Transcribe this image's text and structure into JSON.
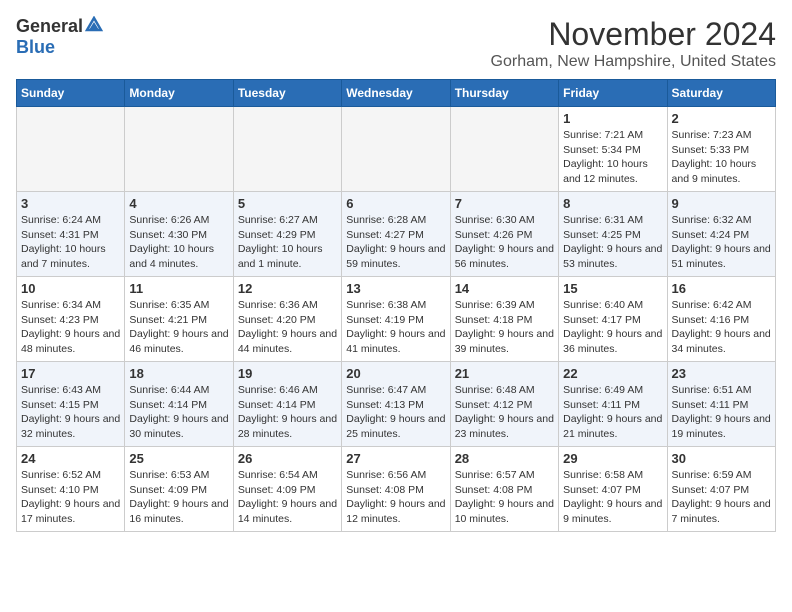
{
  "header": {
    "logo_general": "General",
    "logo_blue": "Blue",
    "month_title": "November 2024",
    "location": "Gorham, New Hampshire, United States"
  },
  "weekdays": [
    "Sunday",
    "Monday",
    "Tuesday",
    "Wednesday",
    "Thursday",
    "Friday",
    "Saturday"
  ],
  "weeks": [
    [
      {
        "day": "",
        "info": ""
      },
      {
        "day": "",
        "info": ""
      },
      {
        "day": "",
        "info": ""
      },
      {
        "day": "",
        "info": ""
      },
      {
        "day": "",
        "info": ""
      },
      {
        "day": "1",
        "info": "Sunrise: 7:21 AM\nSunset: 5:34 PM\nDaylight: 10 hours and 12 minutes."
      },
      {
        "day": "2",
        "info": "Sunrise: 7:23 AM\nSunset: 5:33 PM\nDaylight: 10 hours and 9 minutes."
      }
    ],
    [
      {
        "day": "3",
        "info": "Sunrise: 6:24 AM\nSunset: 4:31 PM\nDaylight: 10 hours and 7 minutes."
      },
      {
        "day": "4",
        "info": "Sunrise: 6:26 AM\nSunset: 4:30 PM\nDaylight: 10 hours and 4 minutes."
      },
      {
        "day": "5",
        "info": "Sunrise: 6:27 AM\nSunset: 4:29 PM\nDaylight: 10 hours and 1 minute."
      },
      {
        "day": "6",
        "info": "Sunrise: 6:28 AM\nSunset: 4:27 PM\nDaylight: 9 hours and 59 minutes."
      },
      {
        "day": "7",
        "info": "Sunrise: 6:30 AM\nSunset: 4:26 PM\nDaylight: 9 hours and 56 minutes."
      },
      {
        "day": "8",
        "info": "Sunrise: 6:31 AM\nSunset: 4:25 PM\nDaylight: 9 hours and 53 minutes."
      },
      {
        "day": "9",
        "info": "Sunrise: 6:32 AM\nSunset: 4:24 PM\nDaylight: 9 hours and 51 minutes."
      }
    ],
    [
      {
        "day": "10",
        "info": "Sunrise: 6:34 AM\nSunset: 4:23 PM\nDaylight: 9 hours and 48 minutes."
      },
      {
        "day": "11",
        "info": "Sunrise: 6:35 AM\nSunset: 4:21 PM\nDaylight: 9 hours and 46 minutes."
      },
      {
        "day": "12",
        "info": "Sunrise: 6:36 AM\nSunset: 4:20 PM\nDaylight: 9 hours and 44 minutes."
      },
      {
        "day": "13",
        "info": "Sunrise: 6:38 AM\nSunset: 4:19 PM\nDaylight: 9 hours and 41 minutes."
      },
      {
        "day": "14",
        "info": "Sunrise: 6:39 AM\nSunset: 4:18 PM\nDaylight: 9 hours and 39 minutes."
      },
      {
        "day": "15",
        "info": "Sunrise: 6:40 AM\nSunset: 4:17 PM\nDaylight: 9 hours and 36 minutes."
      },
      {
        "day": "16",
        "info": "Sunrise: 6:42 AM\nSunset: 4:16 PM\nDaylight: 9 hours and 34 minutes."
      }
    ],
    [
      {
        "day": "17",
        "info": "Sunrise: 6:43 AM\nSunset: 4:15 PM\nDaylight: 9 hours and 32 minutes."
      },
      {
        "day": "18",
        "info": "Sunrise: 6:44 AM\nSunset: 4:14 PM\nDaylight: 9 hours and 30 minutes."
      },
      {
        "day": "19",
        "info": "Sunrise: 6:46 AM\nSunset: 4:14 PM\nDaylight: 9 hours and 28 minutes."
      },
      {
        "day": "20",
        "info": "Sunrise: 6:47 AM\nSunset: 4:13 PM\nDaylight: 9 hours and 25 minutes."
      },
      {
        "day": "21",
        "info": "Sunrise: 6:48 AM\nSunset: 4:12 PM\nDaylight: 9 hours and 23 minutes."
      },
      {
        "day": "22",
        "info": "Sunrise: 6:49 AM\nSunset: 4:11 PM\nDaylight: 9 hours and 21 minutes."
      },
      {
        "day": "23",
        "info": "Sunrise: 6:51 AM\nSunset: 4:11 PM\nDaylight: 9 hours and 19 minutes."
      }
    ],
    [
      {
        "day": "24",
        "info": "Sunrise: 6:52 AM\nSunset: 4:10 PM\nDaylight: 9 hours and 17 minutes."
      },
      {
        "day": "25",
        "info": "Sunrise: 6:53 AM\nSunset: 4:09 PM\nDaylight: 9 hours and 16 minutes."
      },
      {
        "day": "26",
        "info": "Sunrise: 6:54 AM\nSunset: 4:09 PM\nDaylight: 9 hours and 14 minutes."
      },
      {
        "day": "27",
        "info": "Sunrise: 6:56 AM\nSunset: 4:08 PM\nDaylight: 9 hours and 12 minutes."
      },
      {
        "day": "28",
        "info": "Sunrise: 6:57 AM\nSunset: 4:08 PM\nDaylight: 9 hours and 10 minutes."
      },
      {
        "day": "29",
        "info": "Sunrise: 6:58 AM\nSunset: 4:07 PM\nDaylight: 9 hours and 9 minutes."
      },
      {
        "day": "30",
        "info": "Sunrise: 6:59 AM\nSunset: 4:07 PM\nDaylight: 9 hours and 7 minutes."
      }
    ]
  ]
}
